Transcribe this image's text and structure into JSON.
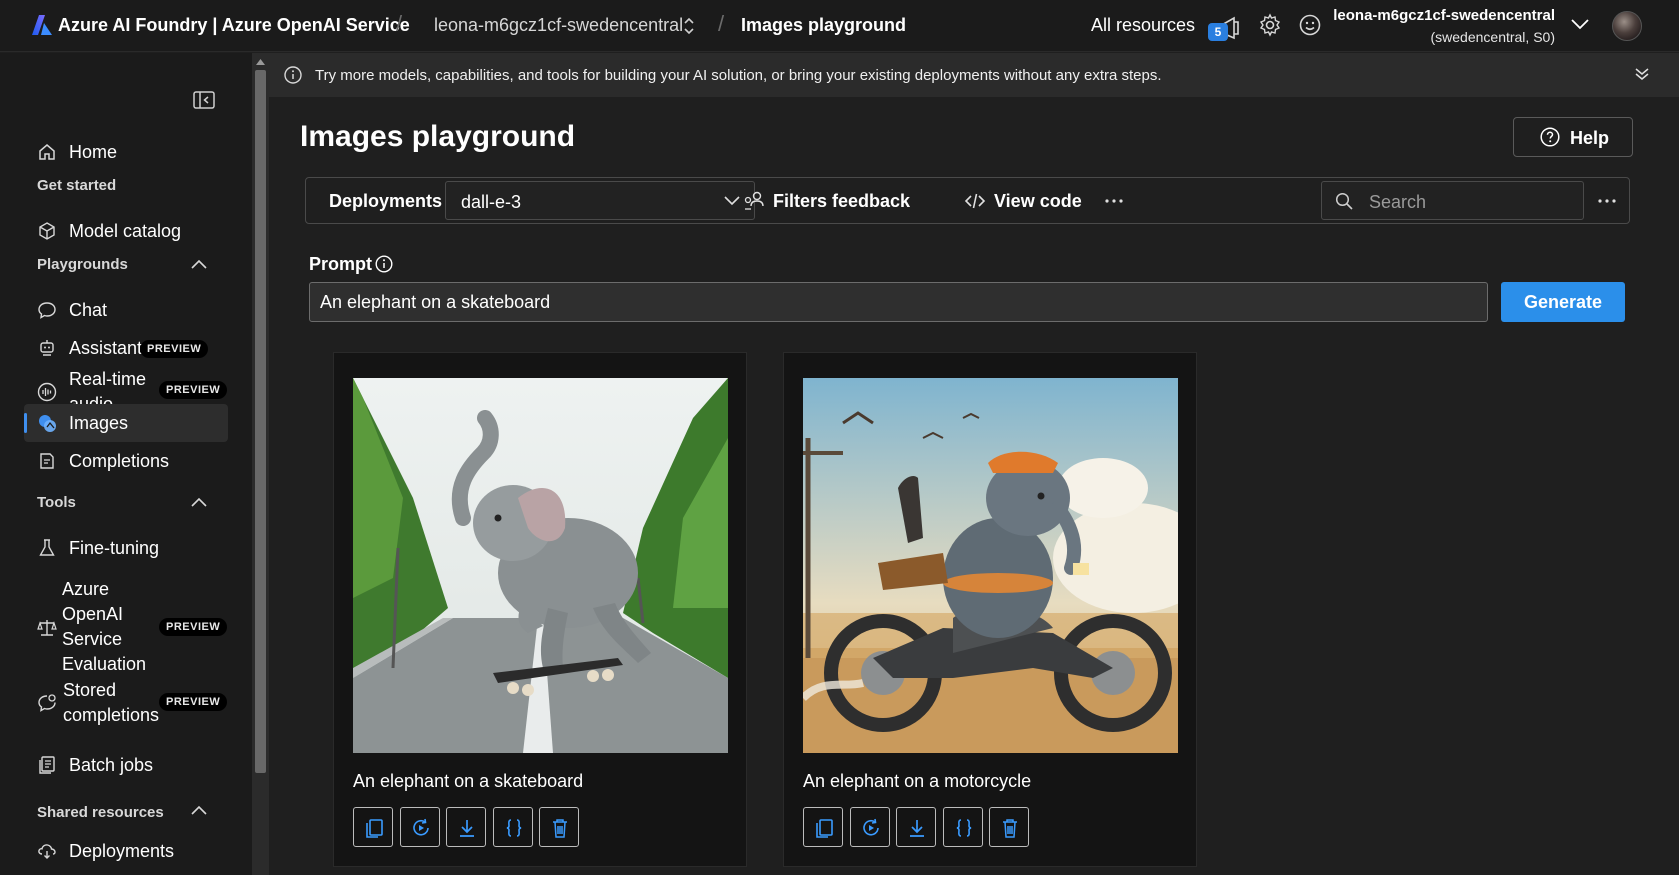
{
  "header": {
    "brand": "Azure AI Foundry | Azure OpenAI Service",
    "resource": "leona-m6gcz1cf-swedencentral",
    "page": "Images playground",
    "all_resources": "All resources",
    "notification_count": "5",
    "account_name": "leona-m6gcz1cf-swedencentral",
    "account_sub": "(swedencentral, S0)"
  },
  "sidebar": {
    "home": "Home",
    "get_started": "Get started",
    "model_catalog": "Model catalog",
    "playgrounds": "Playgrounds",
    "chat": "Chat",
    "assistants": "Assistants",
    "realtime_audio": "Real-time audio",
    "images": "Images",
    "completions": "Completions",
    "tools": "Tools",
    "fine_tuning": "Fine-tuning",
    "aoai_eval": "Azure OpenAI Service Evaluation",
    "stored_completions": "Stored completions",
    "batch_jobs": "Batch jobs",
    "shared_resources": "Shared resources",
    "deployments": "Deployments",
    "preview": "PREVIEW"
  },
  "banner": {
    "text": "Try more models, capabilities, and tools for building your AI solution, or bring your existing deployments without any extra steps."
  },
  "main": {
    "title": "Images playground",
    "help": "Help",
    "deployments_label": "Deployments",
    "deployment_value": "dall-e-3",
    "filters_feedback": "Filters feedback",
    "view_code": "View code",
    "search_placeholder": "Search",
    "prompt_label": "Prompt",
    "prompt_value": "An elephant on a skateboard",
    "generate": "Generate"
  },
  "cards": [
    {
      "caption": "An elephant on a skateboard"
    },
    {
      "caption": "An elephant on a motorcycle"
    }
  ],
  "colors": {
    "accent": "#2b8fea",
    "background": "#1f1f1f",
    "sidebar": "#1b1b1b"
  }
}
